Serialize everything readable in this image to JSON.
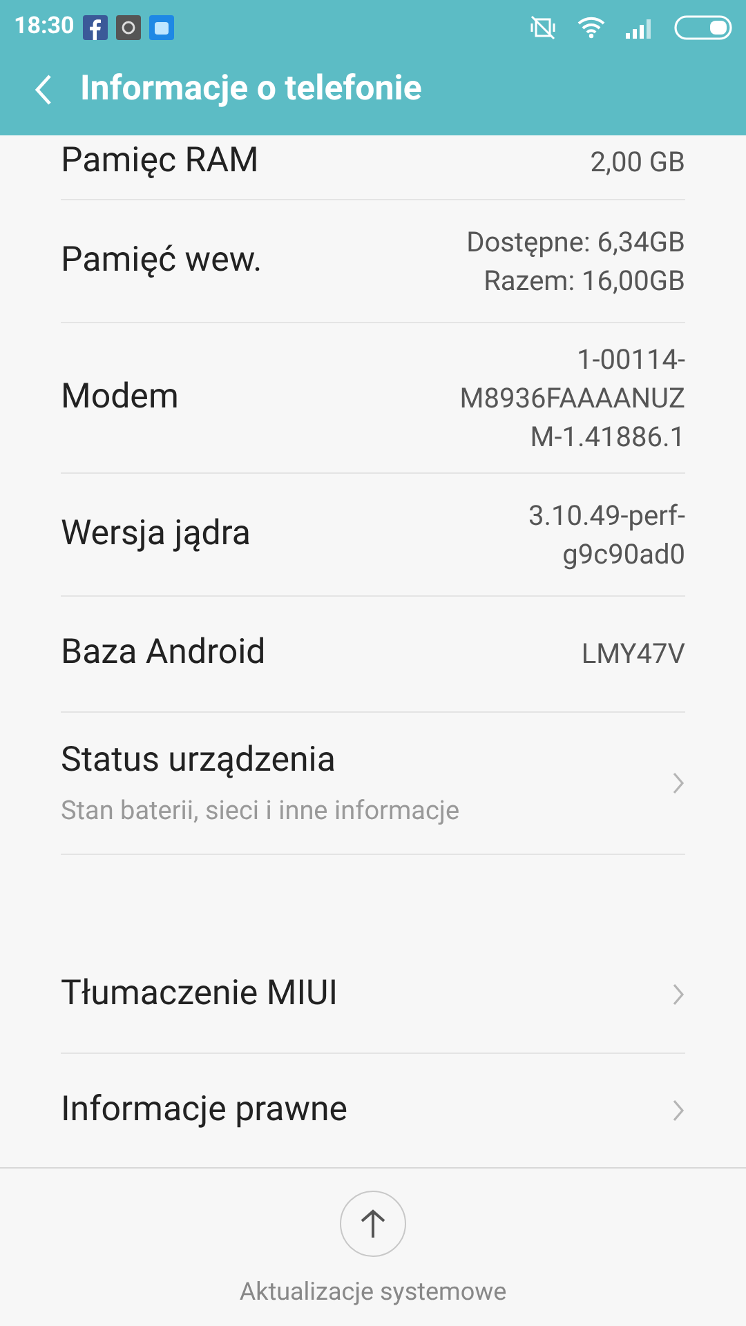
{
  "status_bar": {
    "time": "18:30"
  },
  "header": {
    "title": "Informacje o telefonie"
  },
  "sections": [
    {
      "rows": [
        {
          "kind": "value",
          "label": "Pamięc RAM",
          "value_lines": [
            "2,00 GB"
          ]
        },
        {
          "kind": "value",
          "label": "Pamięć wew.",
          "value_lines": [
            "Dostępne: 6,34GB",
            "Razem: 16,00GB"
          ]
        },
        {
          "kind": "value",
          "label": "Modem",
          "value_lines": [
            "1-00114-",
            "M8936FAAAANUZ",
            "M-1.41886.1"
          ]
        },
        {
          "kind": "value",
          "label": "Wersja jądra",
          "value_lines": [
            "3.10.49-perf-",
            "g9c90ad0"
          ]
        },
        {
          "kind": "value",
          "label": "Baza Android",
          "value_lines": [
            "LMY47V"
          ]
        },
        {
          "kind": "link",
          "label": "Status urządzenia",
          "subtitle": "Stan baterii, sieci i inne informacje"
        }
      ]
    },
    {
      "rows": [
        {
          "kind": "link",
          "label": "Tłumaczenie MIUI"
        },
        {
          "kind": "link",
          "label": "Informacje prawne"
        }
      ]
    }
  ],
  "footer": {
    "label": "Aktualizacje systemowe"
  }
}
